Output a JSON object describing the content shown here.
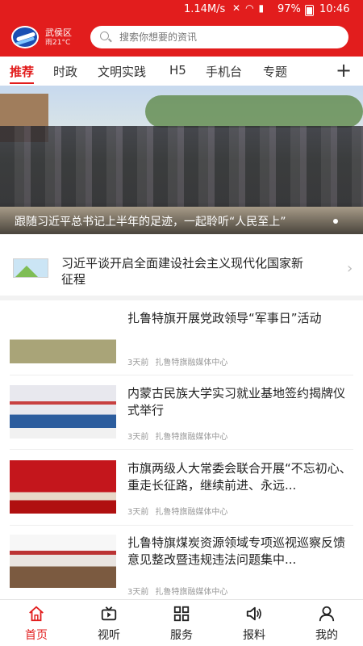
{
  "status_bar": {
    "speed": "1.14M/s",
    "battery": "97%",
    "time": "10:46"
  },
  "header": {
    "district": "武侯区",
    "weather": "雨21°C",
    "search_placeholder": "搜索你想要的资讯"
  },
  "tabs": [
    {
      "label": "推荐",
      "active": true
    },
    {
      "label": "时政"
    },
    {
      "label": "文明实践"
    },
    {
      "label": "H5"
    },
    {
      "label": "手机台"
    },
    {
      "label": "专题"
    }
  ],
  "hero": {
    "caption": "跟随习近平总书记上半年的足迹，一起聆听“人民至上”"
  },
  "special": {
    "title": "习近平谈开启全面建设社会主义现代化国家新征程"
  },
  "news": [
    {
      "title": "扎鲁特旗开展党政领导“军事日”活动",
      "time": "3天前",
      "source": "扎鲁特旗融媒体中心"
    },
    {
      "title": "内蒙古民族大学实习就业基地签约揭牌仪式举行",
      "time": "3天前",
      "source": "扎鲁特旗融媒体中心"
    },
    {
      "title": "市旗两级人大常委会联合开展“不忘初心、重走长征路，继续前进、永远...",
      "time": "3天前",
      "source": "扎鲁特旗融媒体中心"
    },
    {
      "title": "扎鲁特旗煤炭资源领域专项巡视巡察反馈意见整改暨违规违法问题集中...",
      "time": "3天前",
      "source": "扎鲁特旗融媒体中心"
    }
  ],
  "bottom_nav": [
    {
      "label": "首页",
      "icon": "home-icon",
      "active": true
    },
    {
      "label": "视听",
      "icon": "video-icon"
    },
    {
      "label": "服务",
      "icon": "grid-icon"
    },
    {
      "label": "报料",
      "icon": "speaker-icon"
    },
    {
      "label": "我的",
      "icon": "user-icon"
    }
  ],
  "colors": {
    "brand": "#e21d1d",
    "logo": "#1b4fb3"
  }
}
